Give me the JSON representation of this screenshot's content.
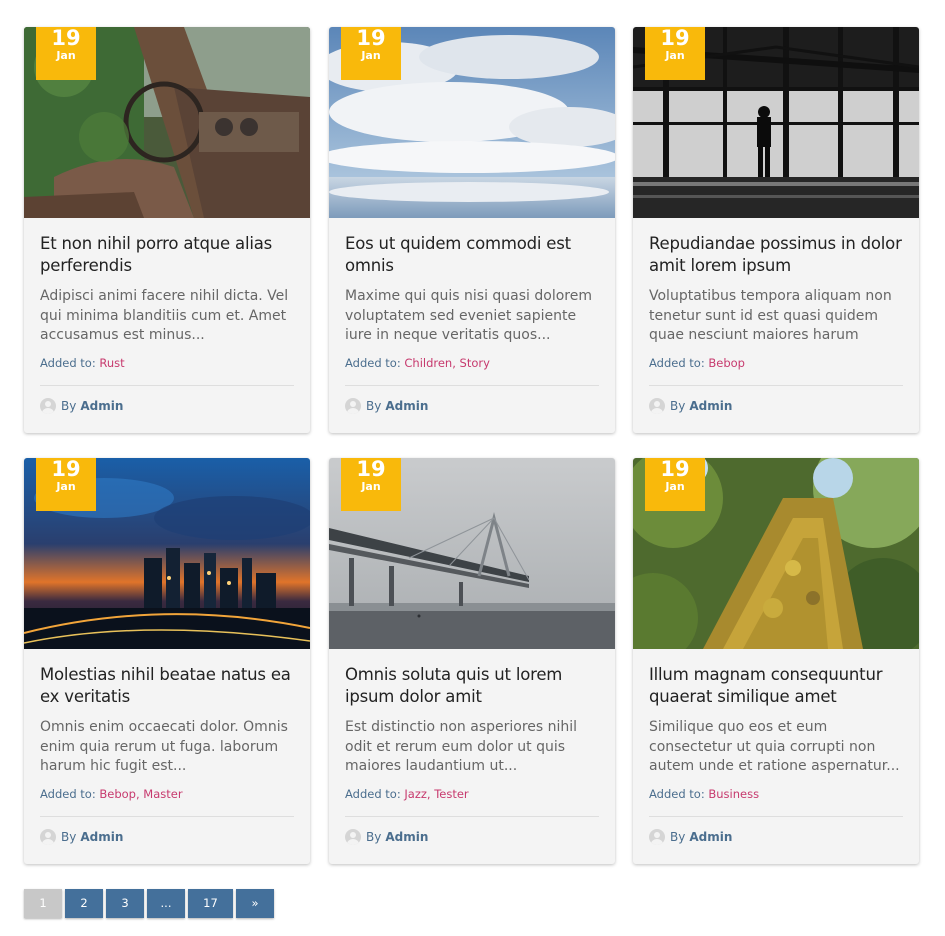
{
  "posts": [
    {
      "day": "19",
      "month": "Jan",
      "title": "Et non nihil porro atque alias perferendis",
      "excerpt": "Adipisci animi facere nihil dicta. Vel qui minima blanditiis cum et. Amet accusamus est minus...",
      "added_label": "Added to:",
      "tags": "Rust",
      "author_by": "By",
      "author": "Admin",
      "image": "abandoned-car-interior"
    },
    {
      "day": "19",
      "month": "Jan",
      "title": "Eos ut quidem commodi est omnis",
      "excerpt": "Maxime qui quis nisi quasi dolorem voluptatem sed eveniet sapiente iure in neque veritatis quos...",
      "added_label": "Added to:",
      "tags": "Children, Story",
      "author_by": "By",
      "author": "Admin",
      "image": "cloudy-sky-reflection"
    },
    {
      "day": "19",
      "month": "Jan",
      "title": "Repudiandae possimus in dolor amit lorem ipsum",
      "excerpt": "Voluptatibus tempora aliquam non tenetur sunt id est quasi quidem quae nesciunt maiores harum quibusdam...",
      "added_label": "Added to:",
      "tags": "Bebop",
      "author_by": "By",
      "author": "Admin",
      "image": "silhouette-airport"
    },
    {
      "day": "19",
      "month": "Jan",
      "title": "Molestias nihil beatae natus ea ex veritatis",
      "excerpt": "Omnis enim occaecati dolor. Omnis enim quia rerum ut fuga. laborum harum hic fugit est...",
      "added_label": "Added to:",
      "tags": "Bebop, Master",
      "author_by": "By",
      "author": "Admin",
      "image": "city-skyline-sunset"
    },
    {
      "day": "19",
      "month": "Jan",
      "title": "Omnis soluta quis ut lorem ipsum dolor amit",
      "excerpt": "Est distinctio non asperiores nihil odit et rerum eum dolor ut quis maiores laudantium ut...",
      "added_label": "Added to:",
      "tags": "Jazz, Tester",
      "author_by": "By",
      "author": "Admin",
      "image": "foggy-bridge"
    },
    {
      "day": "19",
      "month": "Jan",
      "title": "Illum magnam consequuntur quaerat similique amet",
      "excerpt": "Similique quo eos et eum consectetur ut quia corrupti non autem unde et ratione aspernatur...",
      "added_label": "Added to:",
      "tags": "Business",
      "author_by": "By",
      "author": "Admin",
      "image": "mossy-tree-trunk"
    }
  ],
  "pagination": {
    "pages": [
      "1",
      "2",
      "3",
      "...",
      "17",
      "»"
    ],
    "current": "1"
  },
  "colors": {
    "badge": "#f9b90b",
    "tag": "#c73a6e",
    "accent": "#44709b",
    "text_link": "#4b6e8e"
  }
}
